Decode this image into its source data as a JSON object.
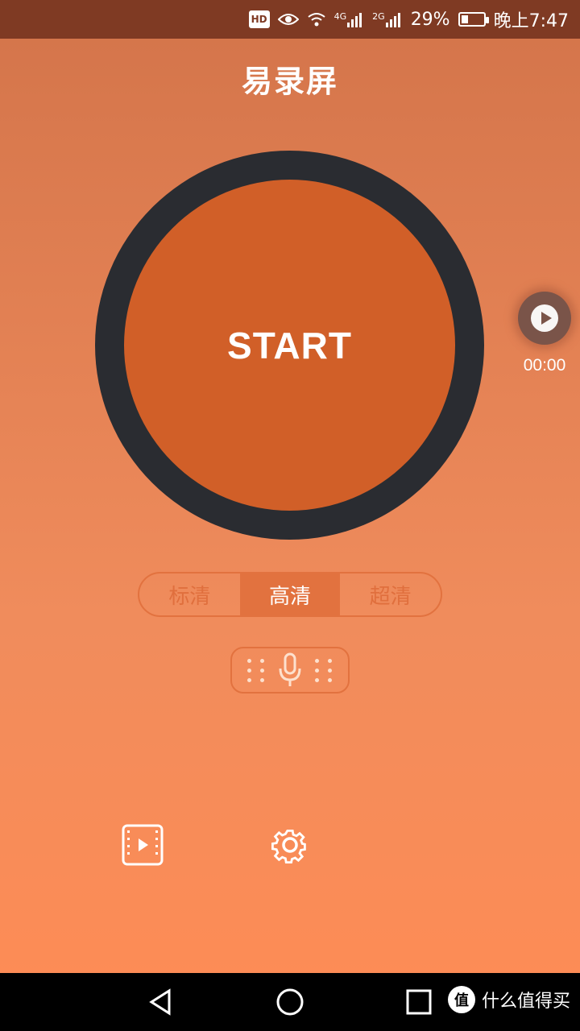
{
  "status_bar": {
    "hd": "HD",
    "net1": "4G",
    "net2": "2G",
    "battery_pct": "29%",
    "time": "晚上7:47",
    "icons": [
      "hd-icon",
      "eye-icon",
      "wifi-icon",
      "signal-icon",
      "battery-icon"
    ]
  },
  "app": {
    "title": "易录屏"
  },
  "record": {
    "start_label": "START"
  },
  "playback": {
    "timer": "00:00"
  },
  "quality": {
    "options": [
      "标清",
      "高清",
      "超清"
    ],
    "selected": "高清"
  },
  "audio": {
    "icon": "microphone-icon"
  },
  "bottom": {
    "video_icon": "video-list-icon",
    "settings_icon": "gear-icon"
  },
  "navigation": {
    "icons": [
      "back-icon",
      "home-icon",
      "recents-icon"
    ]
  },
  "watermark": {
    "badge": "值",
    "text": "什么值得买"
  },
  "colors": {
    "status_bar": "#7f3a23",
    "ring": "#2a2c31",
    "start_fill": "#d15f28",
    "accent": "#e2723f"
  }
}
